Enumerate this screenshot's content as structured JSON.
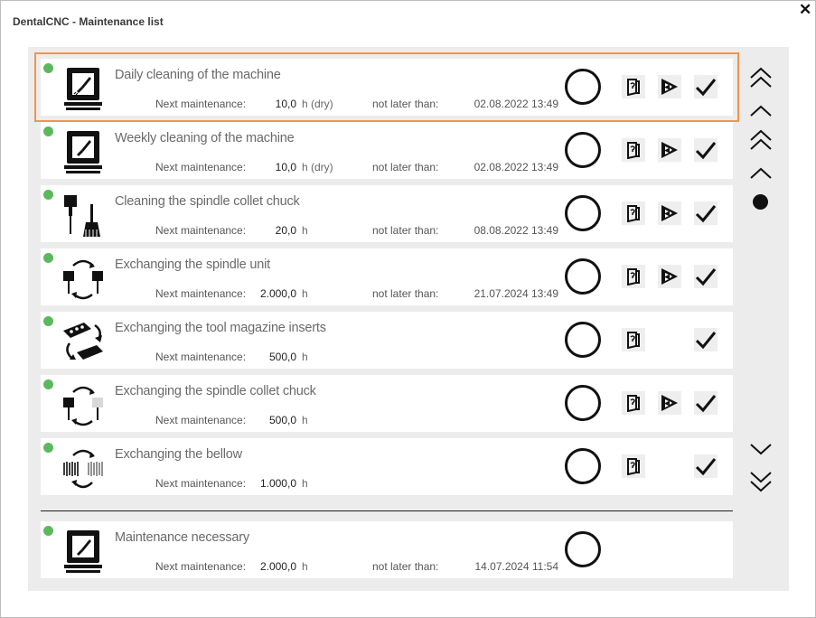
{
  "window": {
    "title": "DentalCNC - Maintenance list"
  },
  "labels": {
    "next_maintenance": "Next maintenance:",
    "not_later_than": "not later than:"
  },
  "rows": [
    {
      "name": "Daily cleaning of the machine",
      "value": "10,0",
      "unit": "h (dry)",
      "date": "02.08.2022 13:49",
      "icon": "machine-cleaning-icon",
      "selected": true
    },
    {
      "name": "Weekly cleaning of the machine",
      "value": "10,0",
      "unit": "h (dry)",
      "date": "02.08.2022 13:49",
      "icon": "machine-cleaning-icon"
    },
    {
      "name": "Cleaning the spindle collet chuck",
      "value": "20,0",
      "unit": "h",
      "date": "08.08.2022 13:49",
      "icon": "spindle-brush-icon"
    },
    {
      "name": "Exchanging the spindle unit",
      "value": "2.000,0",
      "unit": "h",
      "date": "21.07.2024 13:49",
      "icon": "spindle-exchange-icon"
    },
    {
      "name": "Exchanging the tool magazine inserts",
      "value": "500,0",
      "unit": "h",
      "date": "",
      "icon": "magazine-exchange-icon"
    },
    {
      "name": "Exchanging the spindle collet chuck",
      "value": "500,0",
      "unit": "h",
      "date": "",
      "icon": "collet-exchange-icon"
    },
    {
      "name": "Exchanging the bellow",
      "value": "1.000,0",
      "unit": "h",
      "date": "",
      "icon": "bellow-exchange-icon"
    }
  ],
  "summary_row": {
    "name": "Maintenance necessary",
    "value": "2.000,0",
    "unit": "h",
    "date": "14.07.2024 11:54",
    "icon": "machine-cleaning-icon"
  },
  "icons": {
    "status": "status-dot-icon",
    "manual": "manual-book-icon",
    "video": "video-play-icon",
    "confirm": "checkmark-icon"
  },
  "colors": {
    "status_ok": "#5cb85c",
    "selection_outline": "#f0944d",
    "panel_bg": "#ececec"
  }
}
